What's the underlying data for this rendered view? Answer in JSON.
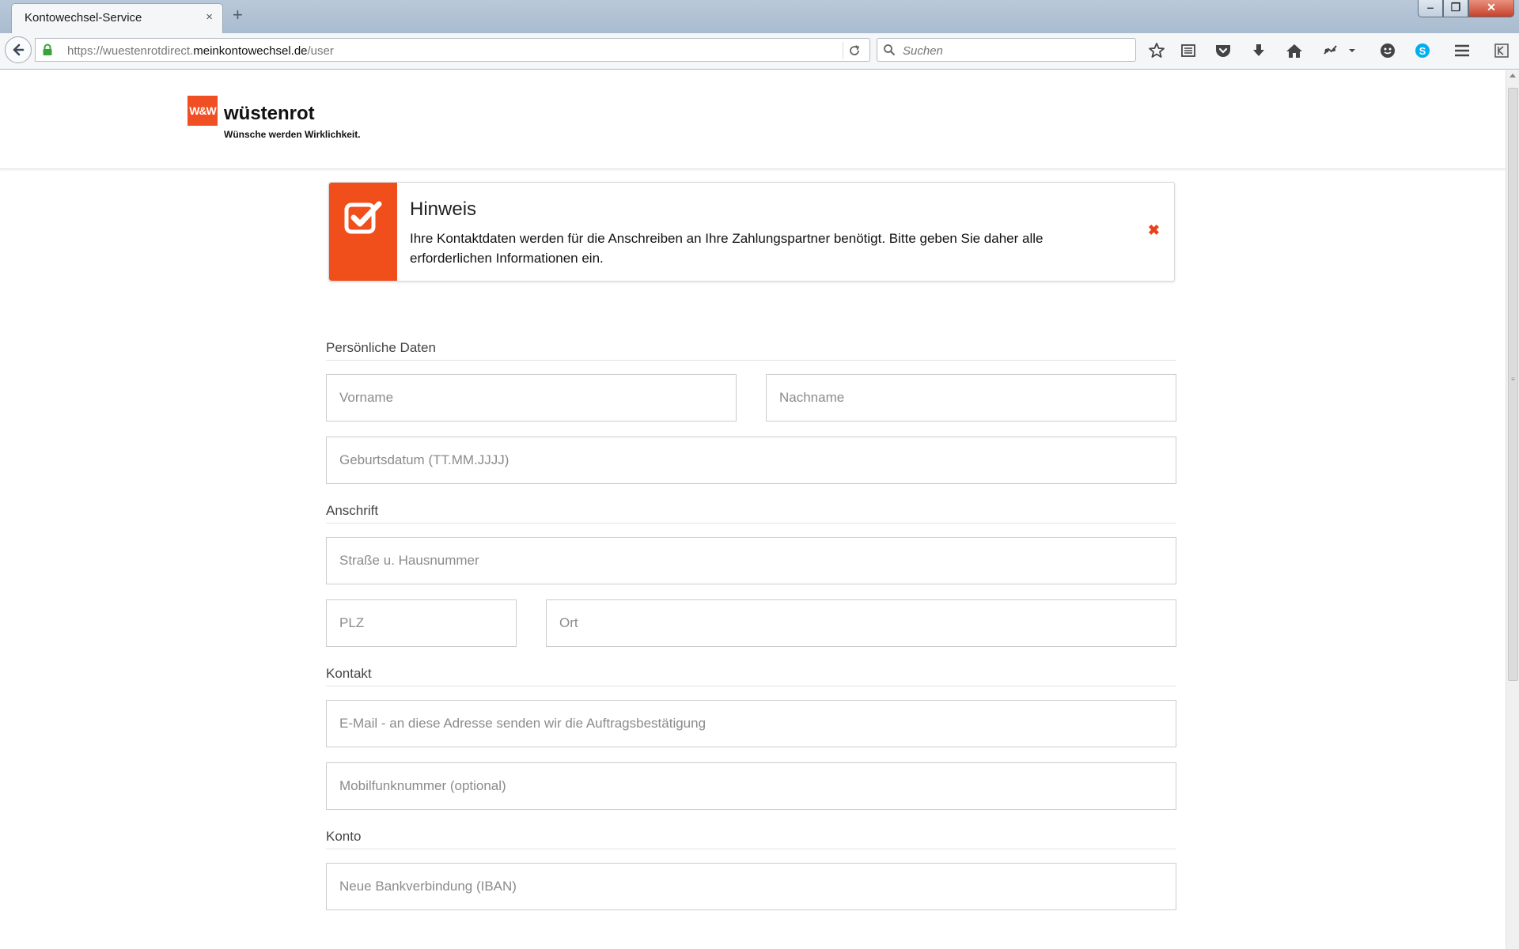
{
  "browser": {
    "tab_title": "Kontowechsel-Service",
    "tab_close": "×",
    "new_tab": "+",
    "url_prefix": "https://wuestenrotdirect.",
    "url_host": "meinkontowechsel.de",
    "url_path": "/user",
    "search_placeholder": "Suchen",
    "window_controls": {
      "minimize": "‒",
      "maximize": "❐",
      "close": "✕"
    }
  },
  "brand": {
    "logo_mark": "W&W",
    "name": "wüstenrot",
    "tagline": "Wünsche werden Wirklichkeit.",
    "accent_color": "#f04e1b"
  },
  "notice": {
    "title": "Hinweis",
    "text": "Ihre Kontaktdaten werden für die Anschreiben an Ihre Zahlungspartner benötigt. Bitte geben Sie daher alle erforderlichen Informationen ein.",
    "close": "✖"
  },
  "form": {
    "personal": {
      "label": "Persönliche Daten",
      "first_name_placeholder": "Vorname",
      "last_name_placeholder": "Nachname",
      "birthdate_placeholder": "Geburtsdatum (TT.MM.JJJJ)"
    },
    "address": {
      "label": "Anschrift",
      "street_placeholder": "Straße u. Hausnummer",
      "zip_placeholder": "PLZ",
      "city_placeholder": "Ort"
    },
    "contact": {
      "label": "Kontakt",
      "email_placeholder": "E-Mail - an diese Adresse senden wir die Auftragsbestätigung",
      "mobile_placeholder": "Mobilfunknummer (optional)"
    },
    "account": {
      "label": "Konto",
      "iban_placeholder": "Neue Bankverbindung (IBAN)"
    }
  }
}
